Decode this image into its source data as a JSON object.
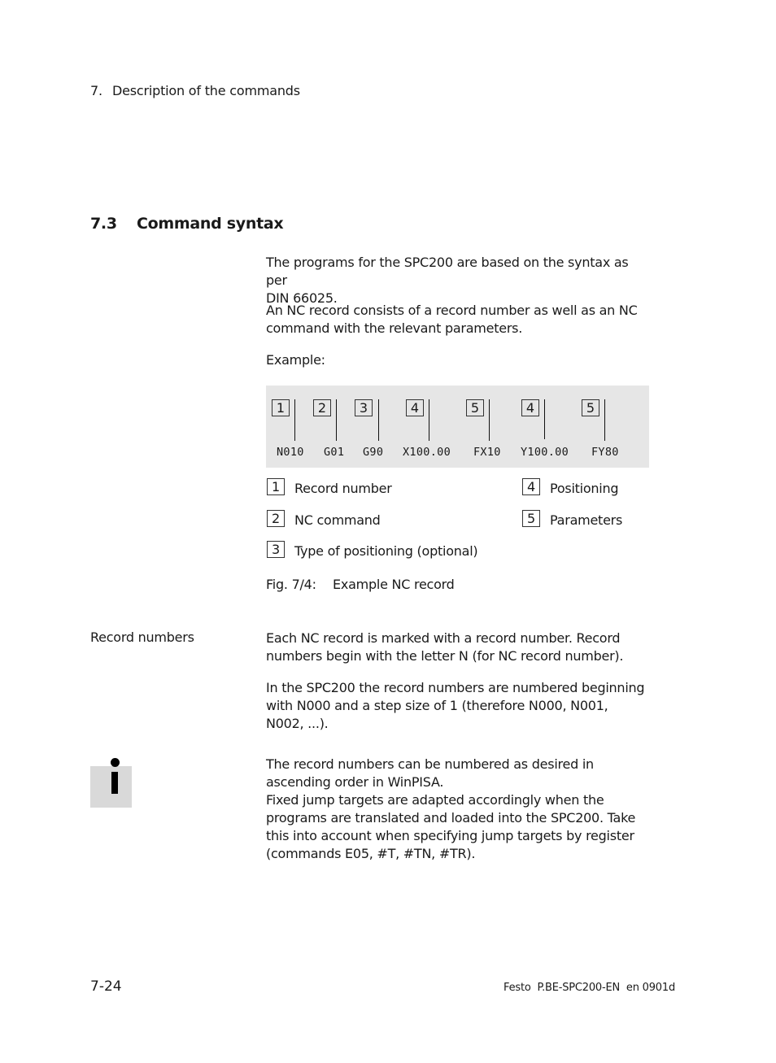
{
  "header": {
    "chapter_number": "7.",
    "chapter_title": "Description of the commands"
  },
  "section": {
    "number": "7.3",
    "title": "Command syntax"
  },
  "intro": {
    "paragraph_1_line_1": "The programs for the SPC200 are based on the syntax as per",
    "paragraph_1_line_2": "DIN 66025.",
    "paragraph_2_line_1": "An NC record consists of a record number as well as an NC",
    "paragraph_2_line_2": "command with the relevant parameters.",
    "example_label": "Example:"
  },
  "example": {
    "tokens": [
      {
        "marker": "1",
        "code": "N010"
      },
      {
        "marker": "2",
        "code": "G01"
      },
      {
        "marker": "3",
        "code": "G90"
      },
      {
        "marker": "4",
        "code": "X100.00"
      },
      {
        "marker": "5",
        "code": "FX10"
      },
      {
        "marker": "4",
        "code": "Y100.00"
      },
      {
        "marker": "5",
        "code": "FY80"
      }
    ],
    "legend": [
      {
        "marker": "1",
        "label": "Record number"
      },
      {
        "marker": "2",
        "label": "NC command"
      },
      {
        "marker": "3",
        "label": "Type of positioning (optional)"
      },
      {
        "marker": "4",
        "label": "Positioning"
      },
      {
        "marker": "5",
        "label": "Parameters"
      }
    ],
    "caption_number": "Fig. 7/4:",
    "caption_text": "Example NC record"
  },
  "record_numbers": {
    "side_label": "Record numbers",
    "p1_line_1": "Each NC record is marked with a record number. Record",
    "p1_line_2": "numbers begin with the letter N (for NC record number).",
    "p2_line_1": "In the SPC200 the record numbers are numbered beginning",
    "p2_line_2": "with N000 and a step size of 1 (therefore N000, N001,",
    "p2_line_3": "N002, ...)."
  },
  "note": {
    "icon": "info-icon",
    "line_1": "The record numbers can be numbered as desired in",
    "line_2": "ascending order in WinPISA.",
    "line_3": "Fixed jump targets are adapted accordingly when the",
    "line_4": "programs are translated and loaded into the SPC200. Take",
    "line_5": "this into account when specifying jump targets by register",
    "line_6": "(commands E05, #T, #TN, #TR)."
  },
  "footer": {
    "page_number": "7-24",
    "document_id": "Festo  P.BE-SPC200-EN  en 0901d"
  }
}
